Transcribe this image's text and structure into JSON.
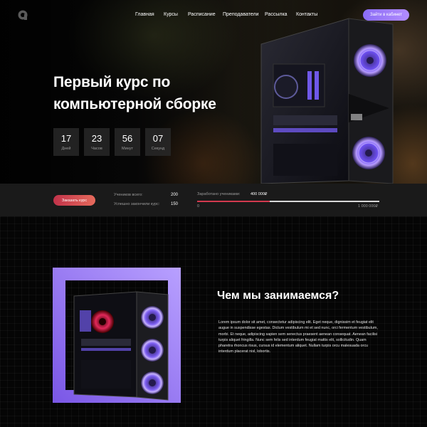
{
  "nav": {
    "items": [
      "Главная",
      "Курсы",
      "Расписание",
      "Преподаватели",
      "Рассылка",
      "Контакты"
    ],
    "cabinet_button": "Зайти в кабинет"
  },
  "hero": {
    "title": "Первый курс по компьютерной сборке",
    "timer": [
      {
        "value": "17",
        "label": "Дней"
      },
      {
        "value": "23",
        "label": "Часов"
      },
      {
        "value": "56",
        "label": "Минут"
      },
      {
        "value": "07",
        "label": "Секунд"
      }
    ]
  },
  "stats": {
    "enroll_button": "Заказать курс",
    "students_label": "Учеников всего:",
    "students_value": "200",
    "graduates_label": "Успешно закончили курс:",
    "graduates_value": "150",
    "earned_label": "Заработано учениками:",
    "earned_current": "400 000₽",
    "earned_min": "0",
    "earned_max": "1 000 000₽",
    "progress_fraction": 0.4
  },
  "about": {
    "title": "Чем мы занимаемся?",
    "text": "Lorem ipsum dolor sit amet, consectetur adipiscing elit. Eget neque, dignissim et feugiat elit augue in suspendisse egestas. Dictum vestibulum mi et sed nunc, orci fermentum vestibulum, morbi. Et neque, adipiscing sapien sem senectus praesent aenean consequat. Aenean facilisi turpis aliquet fringilla. Nunc sem felis sed interdum feugiat mattis elit, sollicitudin. Quam pharetra rhoncus risus, cursus id elementum aliquet. Nullam turpis orcu malesuada orcu interdum placerat nisl, lobortis."
  },
  "colors": {
    "accent_purple": "#9a7bf7",
    "accent_red": "#d23a4e",
    "background": "#000000"
  }
}
